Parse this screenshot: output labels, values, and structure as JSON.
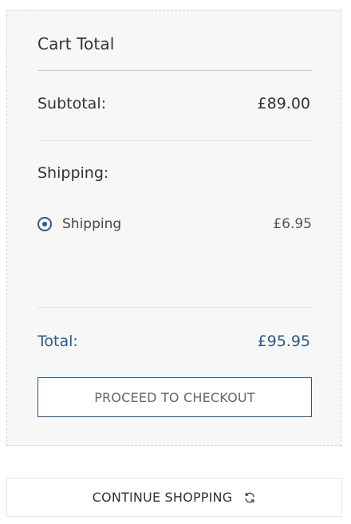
{
  "cart": {
    "title": "Cart Total",
    "subtotal_label": "Subtotal:",
    "subtotal_value": "£89.00",
    "shipping_heading": "Shipping:",
    "shipping_option": {
      "label": "Shipping",
      "price": "£6.95",
      "selected": true
    },
    "total_label": "Total:",
    "total_value": "£95.95",
    "checkout_label": "PROCEED TO CHECKOUT"
  },
  "continue_label": "CONTINUE SHOPPING",
  "icons": {
    "continue": "refresh-icon"
  },
  "colors": {
    "accent": "#2c5a8a",
    "panel_bg": "#f7f7f7"
  }
}
